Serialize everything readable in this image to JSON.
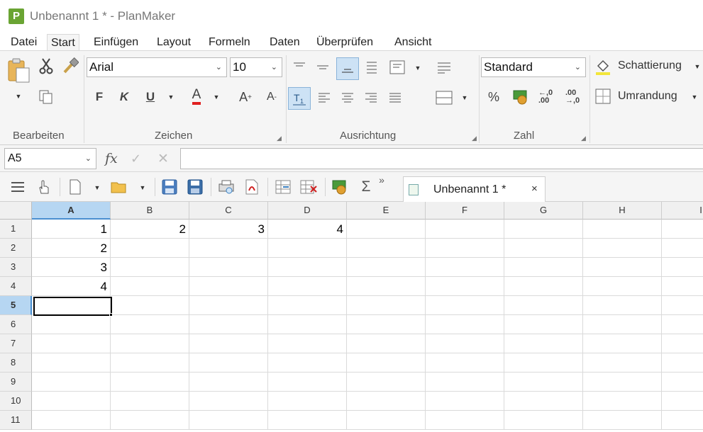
{
  "window": {
    "title": "Unbenannt 1 * - PlanMaker",
    "app_icon_letter": "P",
    "accent": "#6aa433"
  },
  "menu": {
    "tabs": [
      {
        "label": "Datei",
        "active": false
      },
      {
        "label": "Start",
        "active": true
      },
      {
        "label": "Einfügen",
        "active": false
      },
      {
        "label": "Layout",
        "active": false
      },
      {
        "label": "Formeln",
        "active": false
      },
      {
        "label": "Daten",
        "active": false
      },
      {
        "label": "Überprüfen",
        "active": false
      },
      {
        "label": "Ansicht",
        "active": false
      }
    ]
  },
  "ribbon": {
    "groups": {
      "bearbeiten": "Bearbeiten",
      "zeichen": "Zeichen",
      "ausrichtung": "Ausrichtung",
      "zahl": "Zahl"
    },
    "font_name": "Arial",
    "font_size": "10",
    "number_format": "Standard",
    "shading_label": "Schattierung",
    "border_label": "Umrandung",
    "bold": "F",
    "italic": "K",
    "underline": "U",
    "font_color_letter": "A",
    "grow_font": "A",
    "shrink_font": "A",
    "percent": "%",
    "decrease_decimals": "←,0 .00",
    "increase_decimals": ".00 →,0",
    "font_color": "#e02020",
    "shading_color": "#f2e63a"
  },
  "formula_bar": {
    "cell_ref": "A5",
    "fx": "fx",
    "formula": ""
  },
  "quickbar": {
    "overflow": "»",
    "doc_tab": {
      "title": "Unbenannt 1 *",
      "close": "×"
    }
  },
  "sheet": {
    "columns": [
      "A",
      "B",
      "C",
      "D",
      "E",
      "F",
      "G",
      "H",
      "I"
    ],
    "rows": [
      "1",
      "2",
      "3",
      "4",
      "5",
      "6",
      "7",
      "8",
      "9",
      "10",
      "11"
    ],
    "selected_column": "A",
    "selected_row": "5",
    "cells": {
      "A1": "1",
      "B1": "2",
      "C1": "3",
      "D1": "4",
      "A2": "2",
      "A3": "3",
      "A4": "4"
    }
  }
}
